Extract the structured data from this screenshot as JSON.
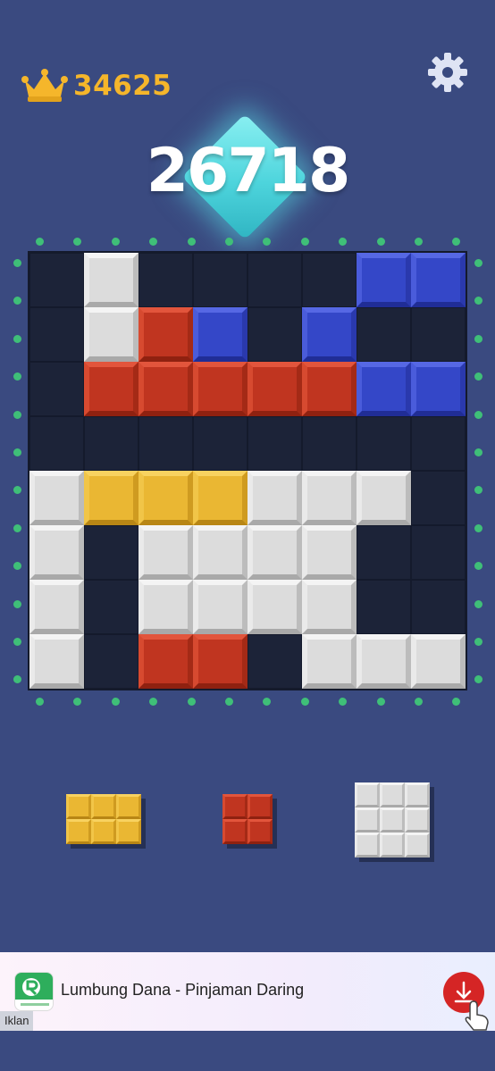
{
  "header": {
    "best_score": "34625",
    "current_score": "26718",
    "top_faint_text": "",
    "icons": {
      "best": "crown-icon",
      "settings": "gear-icon",
      "score_badge": "diamond-gem"
    }
  },
  "colors": {
    "background": "#3a4a80",
    "board": "#1b2238",
    "white_block": "#dcdcdc",
    "red_block": "#c03520",
    "blue_block": "#3447c8",
    "yellow_block": "#eab733",
    "best_score_text": "#f5b62b",
    "border_dots": "#3fbf78",
    "diamond": "#4dd4dc"
  },
  "board": {
    "size": 8,
    "rows": [
      [
        null,
        "white",
        null,
        null,
        null,
        null,
        "blue",
        "blue"
      ],
      [
        null,
        "white",
        "red",
        "blue",
        null,
        "blue",
        null,
        null
      ],
      [
        null,
        "red",
        "red",
        "red",
        "red",
        "red",
        "blue",
        "blue"
      ],
      [
        null,
        null,
        null,
        null,
        null,
        null,
        null,
        null
      ],
      [
        "white",
        "yellow",
        "yellow",
        "yellow",
        "white",
        "white",
        "white",
        null
      ],
      [
        "white",
        null,
        "white",
        "white",
        "white",
        "white",
        null,
        null
      ],
      [
        "white",
        null,
        "white",
        "white",
        "white",
        "white",
        null,
        null
      ],
      [
        "white",
        null,
        "red",
        "red",
        null,
        "white",
        "white",
        "white"
      ]
    ]
  },
  "pieces": [
    {
      "name": "yellow-3x2-piece",
      "color": "yellow",
      "cols": 3,
      "rows": 2
    },
    {
      "name": "red-2x2-piece",
      "color": "red",
      "cols": 2,
      "rows": 2
    },
    {
      "name": "white-3x3-piece",
      "color": "white",
      "cols": 3,
      "rows": 3
    }
  ],
  "ad": {
    "title": "Lumbung Dana - Pinjaman Daring",
    "tag": "Iklan",
    "logo_icon": "lumbung-dana-logo",
    "action_icon": "download-icon"
  }
}
